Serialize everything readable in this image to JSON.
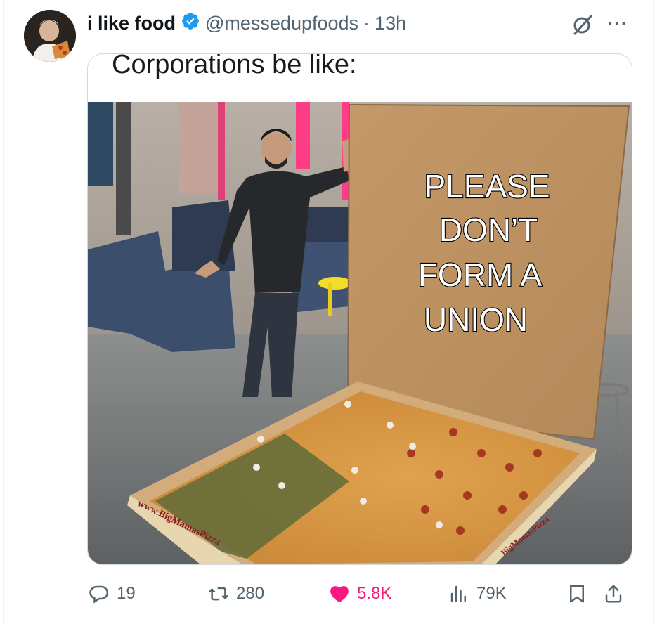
{
  "post": {
    "author_name": "i like food",
    "handle": "@messedupfoods",
    "separator": "·",
    "time": "13h",
    "meme_caption": "Corporations be like:",
    "box_text": [
      "PLEASE",
      "DON’T",
      "FORM A",
      "UNION"
    ],
    "box_side_text": "www.BigMamasPizza",
    "box_side_text_right": "BigMamasPizza"
  },
  "actions": {
    "replies": "19",
    "reposts": "280",
    "likes": "5.8K",
    "views": "79K"
  },
  "icons": {
    "verified": "verified-badge-icon",
    "grok": "grok-icon",
    "more": "more-icon",
    "reply": "reply-icon",
    "repost": "repost-icon",
    "like": "heart-icon",
    "views": "views-icon",
    "bookmark": "bookmark-icon",
    "share": "share-icon"
  },
  "colors": {
    "verified": "#1d9bf0",
    "like": "#f91880",
    "muted": "#536471"
  }
}
